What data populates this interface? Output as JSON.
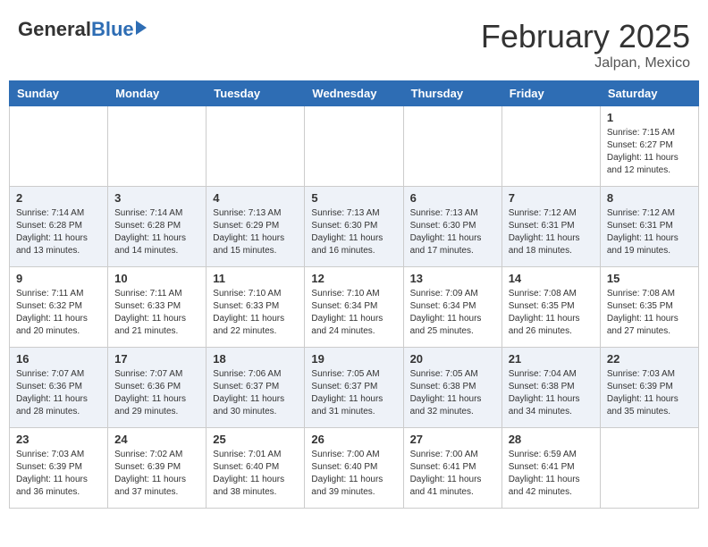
{
  "header": {
    "logo_general": "General",
    "logo_blue": "Blue",
    "month_title": "February 2025",
    "location": "Jalpan, Mexico"
  },
  "weekdays": [
    "Sunday",
    "Monday",
    "Tuesday",
    "Wednesday",
    "Thursday",
    "Friday",
    "Saturday"
  ],
  "weeks": [
    [
      {
        "day": "",
        "info": ""
      },
      {
        "day": "",
        "info": ""
      },
      {
        "day": "",
        "info": ""
      },
      {
        "day": "",
        "info": ""
      },
      {
        "day": "",
        "info": ""
      },
      {
        "day": "",
        "info": ""
      },
      {
        "day": "1",
        "info": "Sunrise: 7:15 AM\nSunset: 6:27 PM\nDaylight: 11 hours\nand 12 minutes."
      }
    ],
    [
      {
        "day": "2",
        "info": "Sunrise: 7:14 AM\nSunset: 6:28 PM\nDaylight: 11 hours\nand 13 minutes."
      },
      {
        "day": "3",
        "info": "Sunrise: 7:14 AM\nSunset: 6:28 PM\nDaylight: 11 hours\nand 14 minutes."
      },
      {
        "day": "4",
        "info": "Sunrise: 7:13 AM\nSunset: 6:29 PM\nDaylight: 11 hours\nand 15 minutes."
      },
      {
        "day": "5",
        "info": "Sunrise: 7:13 AM\nSunset: 6:30 PM\nDaylight: 11 hours\nand 16 minutes."
      },
      {
        "day": "6",
        "info": "Sunrise: 7:13 AM\nSunset: 6:30 PM\nDaylight: 11 hours\nand 17 minutes."
      },
      {
        "day": "7",
        "info": "Sunrise: 7:12 AM\nSunset: 6:31 PM\nDaylight: 11 hours\nand 18 minutes."
      },
      {
        "day": "8",
        "info": "Sunrise: 7:12 AM\nSunset: 6:31 PM\nDaylight: 11 hours\nand 19 minutes."
      }
    ],
    [
      {
        "day": "9",
        "info": "Sunrise: 7:11 AM\nSunset: 6:32 PM\nDaylight: 11 hours\nand 20 minutes."
      },
      {
        "day": "10",
        "info": "Sunrise: 7:11 AM\nSunset: 6:33 PM\nDaylight: 11 hours\nand 21 minutes."
      },
      {
        "day": "11",
        "info": "Sunrise: 7:10 AM\nSunset: 6:33 PM\nDaylight: 11 hours\nand 22 minutes."
      },
      {
        "day": "12",
        "info": "Sunrise: 7:10 AM\nSunset: 6:34 PM\nDaylight: 11 hours\nand 24 minutes."
      },
      {
        "day": "13",
        "info": "Sunrise: 7:09 AM\nSunset: 6:34 PM\nDaylight: 11 hours\nand 25 minutes."
      },
      {
        "day": "14",
        "info": "Sunrise: 7:08 AM\nSunset: 6:35 PM\nDaylight: 11 hours\nand 26 minutes."
      },
      {
        "day": "15",
        "info": "Sunrise: 7:08 AM\nSunset: 6:35 PM\nDaylight: 11 hours\nand 27 minutes."
      }
    ],
    [
      {
        "day": "16",
        "info": "Sunrise: 7:07 AM\nSunset: 6:36 PM\nDaylight: 11 hours\nand 28 minutes."
      },
      {
        "day": "17",
        "info": "Sunrise: 7:07 AM\nSunset: 6:36 PM\nDaylight: 11 hours\nand 29 minutes."
      },
      {
        "day": "18",
        "info": "Sunrise: 7:06 AM\nSunset: 6:37 PM\nDaylight: 11 hours\nand 30 minutes."
      },
      {
        "day": "19",
        "info": "Sunrise: 7:05 AM\nSunset: 6:37 PM\nDaylight: 11 hours\nand 31 minutes."
      },
      {
        "day": "20",
        "info": "Sunrise: 7:05 AM\nSunset: 6:38 PM\nDaylight: 11 hours\nand 32 minutes."
      },
      {
        "day": "21",
        "info": "Sunrise: 7:04 AM\nSunset: 6:38 PM\nDaylight: 11 hours\nand 34 minutes."
      },
      {
        "day": "22",
        "info": "Sunrise: 7:03 AM\nSunset: 6:39 PM\nDaylight: 11 hours\nand 35 minutes."
      }
    ],
    [
      {
        "day": "23",
        "info": "Sunrise: 7:03 AM\nSunset: 6:39 PM\nDaylight: 11 hours\nand 36 minutes."
      },
      {
        "day": "24",
        "info": "Sunrise: 7:02 AM\nSunset: 6:39 PM\nDaylight: 11 hours\nand 37 minutes."
      },
      {
        "day": "25",
        "info": "Sunrise: 7:01 AM\nSunset: 6:40 PM\nDaylight: 11 hours\nand 38 minutes."
      },
      {
        "day": "26",
        "info": "Sunrise: 7:00 AM\nSunset: 6:40 PM\nDaylight: 11 hours\nand 39 minutes."
      },
      {
        "day": "27",
        "info": "Sunrise: 7:00 AM\nSunset: 6:41 PM\nDaylight: 11 hours\nand 41 minutes."
      },
      {
        "day": "28",
        "info": "Sunrise: 6:59 AM\nSunset: 6:41 PM\nDaylight: 11 hours\nand 42 minutes."
      },
      {
        "day": "",
        "info": ""
      }
    ]
  ]
}
